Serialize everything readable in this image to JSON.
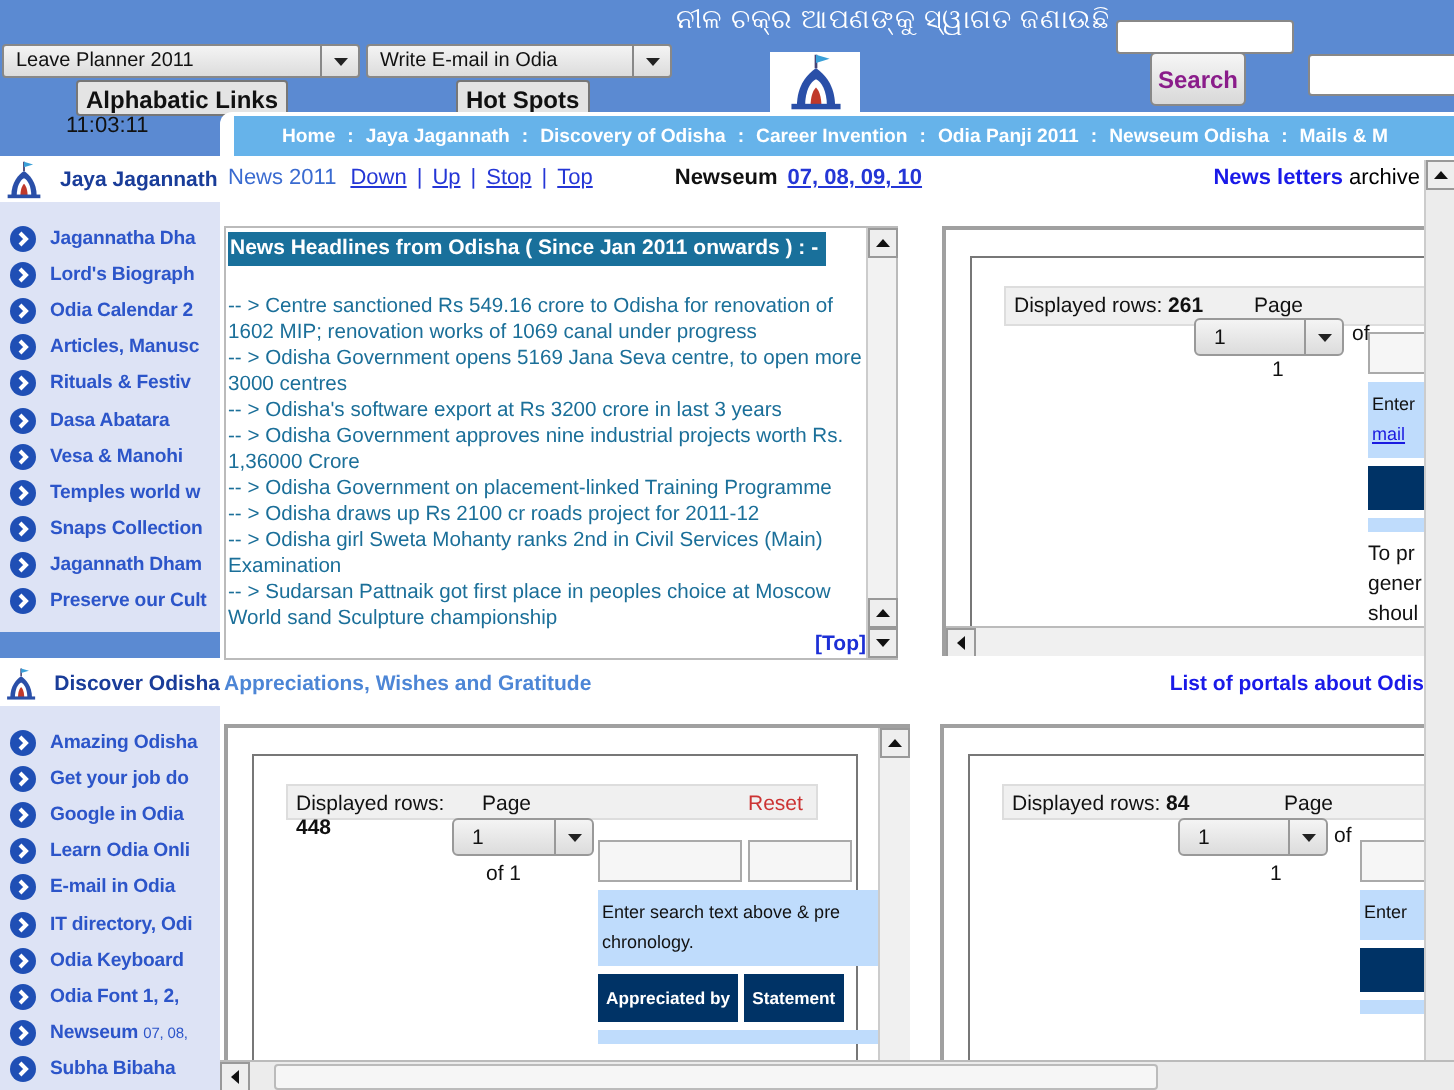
{
  "header": {
    "tagline": "ନୀଳ ଚକ୍ର ଆପଣଙ୍କୁ ସ୍ୱାଗତ ଜଣାଉଛି",
    "dropdowns": [
      "Leave Planner 2011",
      "Write E-mail in Odia"
    ],
    "link_buttons": [
      "Alphabatic Links",
      "Hot Spots"
    ],
    "search_button": "Search",
    "clock": "11:03:11"
  },
  "sidebar": [
    {
      "title": "Jaya Jagannath",
      "items": [
        {
          "label": "Jagannatha Dha"
        },
        {
          "label": "Lord's Biograph"
        },
        {
          "label": "Odia Calendar 2"
        },
        {
          "label": "Articles, Manusc"
        },
        {
          "label": "Rituals & Festiv"
        },
        {
          "label": "Dasa Abatara"
        },
        {
          "label": "Vesa & Manohi"
        },
        {
          "label": "Temples world w"
        },
        {
          "label": "Snaps Collection"
        },
        {
          "label": "Jagannath Dham"
        },
        {
          "label": "Preserve our Cult"
        }
      ]
    },
    {
      "title": "Discover Odisha",
      "items": [
        {
          "label": "Amazing Odisha"
        },
        {
          "label": "Get your job do"
        },
        {
          "label": "Google in Odia"
        },
        {
          "label": "Learn Odia Onli"
        },
        {
          "label": "E-mail in Odia"
        },
        {
          "label": "IT directory, Odi"
        },
        {
          "label": "Odia Keyboard"
        },
        {
          "label": "Odia Font 1, 2,"
        },
        {
          "label": "Newseum",
          "note": "07, 08,"
        },
        {
          "label": "Subha Bibaha"
        }
      ]
    }
  ],
  "nav_bar": {
    "separator": ":",
    "items": [
      "Home",
      "Jaya Jagannath",
      "Discovery of Odisha",
      "Career Invention",
      "Odia Panji 2011",
      "Newseum Odisha",
      "Mails & M"
    ]
  },
  "news_links": {
    "label": "News 2011",
    "separator": "|",
    "links": [
      "Down",
      "Up",
      "Stop",
      "Top"
    ]
  },
  "newseum": {
    "label": "Newseum",
    "issues": "07, 08, 09, 10"
  },
  "newsletters": {
    "link": "News letters",
    "label": "archive"
  },
  "news_box": {
    "title": "News Headlines from Odisha ( Since Jan 2011 onwards ) : -",
    "headlines": [
      "-- > Centre sanctioned Rs 549.16 crore to Odisha for renovation of 1602 MIP; renovation works of 1069 canal under progress",
      "-- > Odisha Government opens 5169 Jana Seva centre, to open more 3000 centres",
      "-- > Odisha's software export at Rs 3200 crore in last 3 years",
      "-- > Odisha Government approves nine industrial projects worth Rs. 1,36000 Crore",
      "-- > Odisha Government on placement-linked Training Programme",
      "-- > Odisha draws up Rs 2100 cr roads project for 2011-12",
      "-- > Odisha girl Sweta Mohanty ranks 2nd in Civil Services (Main) Examination",
      "-- > Sudarsan Pattnaik got first place in peoples choice at Moscow World sand Sculpture championship"
    ],
    "top_link": "[Top]"
  },
  "headings": {
    "appreciations": "Appreciations, Wishes and Gratitude",
    "portals": "List of portals about Odis"
  },
  "frames": [
    {
      "kind": "newsletters",
      "rows": "Displayed rows: **261**",
      "page_label": "Page",
      "page": "1",
      "page_of": [
        "of",
        "1"
      ],
      "hint_lines": [
        "Enter"
      ],
      "hint_link": "mail",
      "notes": [
        "To pr",
        "gener",
        "shoul"
      ]
    },
    {
      "kind": "appreciations",
      "rows": "Displayed rows: **448**",
      "page_label": "Page",
      "reset": "Reset",
      "page": "1",
      "page_of": [
        "of 1"
      ],
      "hint_lines": [
        "Enter search text above & pre",
        "chronology."
      ],
      "columns": [
        "Appreciated by",
        "Statement"
      ]
    },
    {
      "kind": "portals",
      "rows": "Displayed rows: **84**",
      "page_label": "Page",
      "page": "1",
      "page_of": [
        "of",
        "1"
      ],
      "hint_lines": [
        "Enter"
      ]
    }
  ]
}
